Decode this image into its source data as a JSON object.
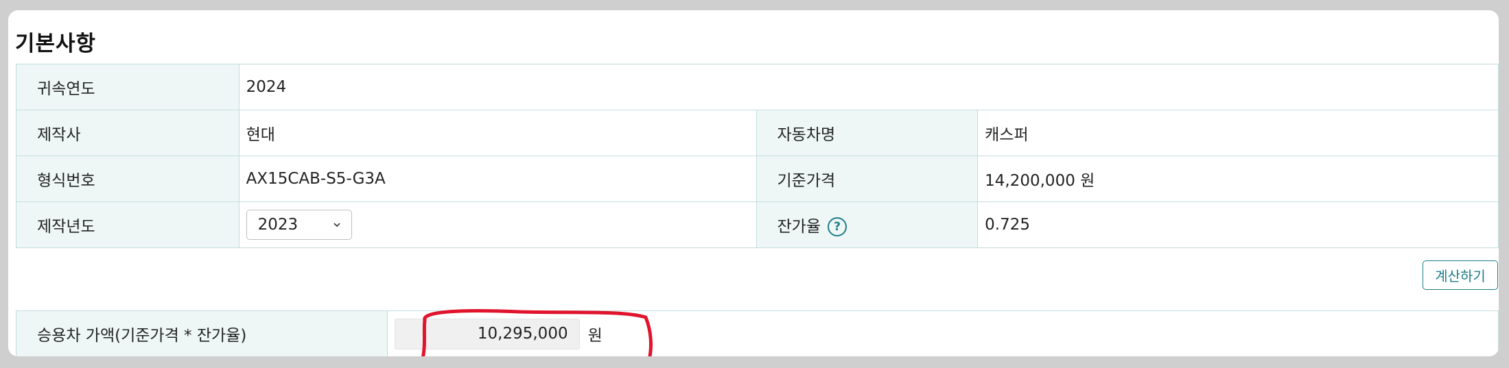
{
  "section": {
    "title": "기본사항"
  },
  "basic": {
    "year_label": "귀속연도",
    "year_value": "2024",
    "maker_label": "제작사",
    "maker_value": "현대",
    "car_name_label": "자동차명",
    "car_name_value": "캐스퍼",
    "model_no_label": "형식번호",
    "model_no_value": "AX15CAB-S5-G3A",
    "base_price_label": "기준가격",
    "base_price_value": "14,200,000 원",
    "mfg_year_label": "제작년도",
    "mfg_year_selected": "2023",
    "residual_label": "잔가율",
    "residual_help": "?",
    "residual_value": "0.725"
  },
  "actions": {
    "calculate_label": "계산하기"
  },
  "result": {
    "label": "승용차 가액(기준가격 * 잔가율)",
    "amount": "10,295,000",
    "unit": "원"
  },
  "colors": {
    "label_bg": "#eef7f6",
    "border": "#c4dcdc",
    "accent": "#1c7d88",
    "annotation": "#e0142c"
  }
}
